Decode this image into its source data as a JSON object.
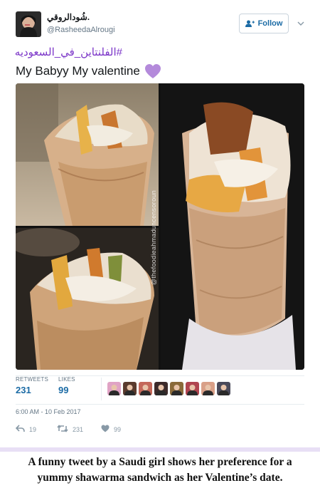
{
  "user": {
    "display_name": "شُودالروقي.",
    "handle": "@RasheedaAlrougi",
    "avatar_icon": "profile-photo"
  },
  "follow_button": {
    "label": "Follow",
    "icon": "add-person-icon"
  },
  "menu": {
    "icon": "chevron-down-icon"
  },
  "tweet": {
    "hashtag": "#الفلنتاين_في_السعوديه",
    "text": "My Babyy My valentine",
    "emoji": "purple-heart"
  },
  "media": {
    "watermark_top": "uncensoroun",
    "watermark_bottom": "@thefoodieahmad"
  },
  "stats": {
    "retweets_label": "RETWEETS",
    "retweets_value": "231",
    "likes_label": "LIKES",
    "likes_value": "99"
  },
  "likers": [
    "#e0a3c5",
    "#5a3b2e",
    "#c4685a",
    "#3c2a2a",
    "#8a6a3a",
    "#b04550",
    "#d9a088",
    "#4a4a5a"
  ],
  "timestamp": "6:00 AM - 10 Feb 2017",
  "actions": {
    "reply_count": "19",
    "retweet_count": "231",
    "like_count": "99"
  },
  "caption": {
    "line1": "A funny tweet by a Saudi girl shows her preference for a",
    "line2": "yummy shawarma sandwich as her Valentine’s date."
  },
  "colors": {
    "link_blue": "#1b6ba5",
    "hashtag_purple": "#7b35c8",
    "muted": "#657786",
    "heart_purple": "#b48adb"
  }
}
